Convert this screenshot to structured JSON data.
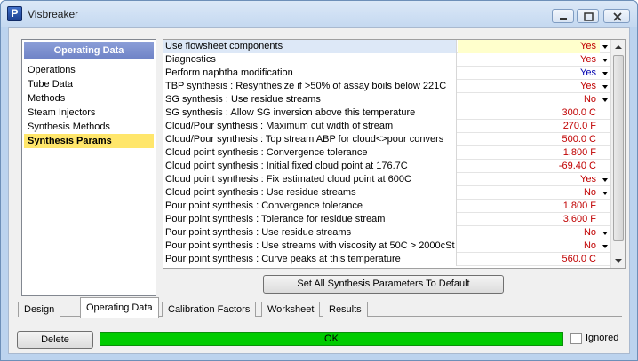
{
  "window": {
    "title": "Visbreaker",
    "icon_letter": "P"
  },
  "sidebar": {
    "header": "Operating Data",
    "items": [
      {
        "label": "Operations"
      },
      {
        "label": "Tube Data"
      },
      {
        "label": "Methods"
      },
      {
        "label": "Steam Injectors"
      },
      {
        "label": "Synthesis Methods"
      },
      {
        "label": "Synthesis Params"
      }
    ],
    "selected": "Synthesis Params"
  },
  "params": [
    {
      "label": "Use flowsheet components",
      "value": "Yes",
      "dropdown": true
    },
    {
      "label": "Diagnostics",
      "value": "Yes",
      "dropdown": true
    },
    {
      "label": "Perform naphtha modification",
      "value": "Yes",
      "dropdown": true,
      "color": "#0000b0"
    },
    {
      "label": "TBP synthesis : Resynthesize if >50% of assay boils below 221C",
      "value": "Yes",
      "dropdown": true
    },
    {
      "label": "SG synthesis : Use residue streams",
      "value": "No",
      "dropdown": true
    },
    {
      "label": "SG synthesis : Allow SG inversion above this temperature",
      "value": "300.0 C",
      "dropdown": false
    },
    {
      "label": "Cloud/Pour synthesis : Maximum cut width of stream",
      "value": "270.0 F",
      "dropdown": false
    },
    {
      "label": "Cloud/Pour synthesis : Top stream ABP for cloud<>pour convers",
      "value": "500.0 C",
      "dropdown": false
    },
    {
      "label": "Cloud point synthesis : Convergence tolerance",
      "value": "1.800 F",
      "dropdown": false
    },
    {
      "label": "Cloud point synthesis : Initial fixed cloud point at 176.7C",
      "value": "-69.40 C",
      "dropdown": false
    },
    {
      "label": "Cloud point synthesis : Fix estimated cloud point at 600C",
      "value": "Yes",
      "dropdown": true
    },
    {
      "label": "Cloud point synthesis : Use residue streams",
      "value": "No",
      "dropdown": true
    },
    {
      "label": "Pour point synthesis : Convergence tolerance",
      "value": "1.800 F",
      "dropdown": false
    },
    {
      "label": "Pour point synthesis : Tolerance for residue stream",
      "value": "3.600 F",
      "dropdown": false
    },
    {
      "label": "Pour point synthesis : Use residue streams",
      "value": "No",
      "dropdown": true
    },
    {
      "label": "Pour point synthesis : Use streams with viscosity at 50C > 2000cSt",
      "value": "No",
      "dropdown": true
    },
    {
      "label": "Pour point synthesis : Curve peaks at this temperature",
      "value": "560.0 C",
      "dropdown": false
    }
  ],
  "default_button": "Set All Synthesis Parameters To Default",
  "tabs": [
    {
      "label": "Design"
    },
    {
      "label": "Operating Data"
    },
    {
      "label": "Calibration Factors"
    },
    {
      "label": "Worksheet"
    },
    {
      "label": "Results"
    }
  ],
  "active_tab": "Operating Data",
  "footer": {
    "delete_label": "Delete",
    "status_text": "OK",
    "ignored_label": "Ignored",
    "status_color": "#00cc00"
  }
}
